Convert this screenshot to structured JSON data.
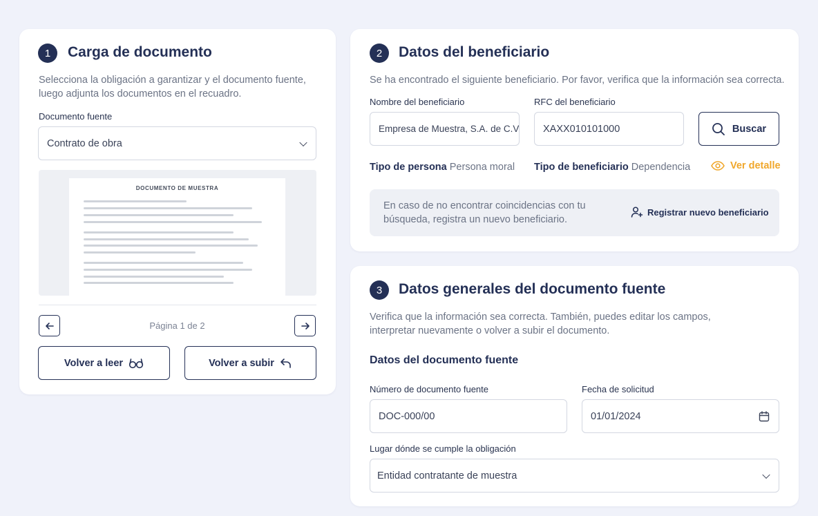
{
  "step1": {
    "number": "1",
    "title": "Carga de documento",
    "description": "Selecciona la obligación a garantizar y el documento fuente, luego adjunta los documentos en el recuadro.",
    "source_doc_label": "Documento fuente",
    "source_doc_value": "Contrato de obra",
    "preview_heading": "DOCUMENTO DE MUESTRA",
    "page_indicator": "Página 1 de 2",
    "reread_label": "Volver a leer",
    "reupload_label": "Volver a subir"
  },
  "step2": {
    "number": "2",
    "title": "Datos del beneficiario",
    "description": "Se ha encontrado el siguiente beneficiario. Por favor, verifica que la información sea correcta.",
    "name_label": "Nombre del beneficiario",
    "name_value": "Empresa de Muestra, S.A. de C.V.",
    "rfc_label": "RFC del beneficiario",
    "rfc_value": "XAXX010101000",
    "search_label": "Buscar",
    "person_type_label": "Tipo de persona",
    "person_type_value": "Persona moral",
    "beneficiary_type_label": "Tipo de beneficiario",
    "beneficiary_type_value": "Dependencia",
    "view_detail_label": "Ver detalle",
    "notice_text": "En caso de no encontrar coincidencias con tu búsqueda, registra un nuevo beneficiario.",
    "register_label": "Registrar nuevo beneficiario"
  },
  "step3": {
    "number": "3",
    "title": "Datos generales del documento fuente",
    "description": "Verifica que la información sea correcta. También, puedes editar los campos, interpretar nuevamente o volver a subir el documento.",
    "subtitle": "Datos del documento fuente",
    "doc_number_label": "Número de documento fuente",
    "doc_number_value": "DOC-000/00",
    "request_date_label": "Fecha de solicitud",
    "request_date_value": "01/01/2024",
    "place_label": "Lugar dónde se cumple la obligación",
    "place_value": "Entidad contratante de muestra"
  },
  "colors": {
    "primary": "#243056",
    "accent": "#f0a72b",
    "background": "#f0f2fa"
  },
  "icons": [
    "arrow-left-icon",
    "arrow-right-icon",
    "glasses-icon",
    "undo-arrow-icon",
    "search-icon",
    "eye-icon",
    "add-user-icon",
    "calendar-icon",
    "chevron-down-icon"
  ]
}
